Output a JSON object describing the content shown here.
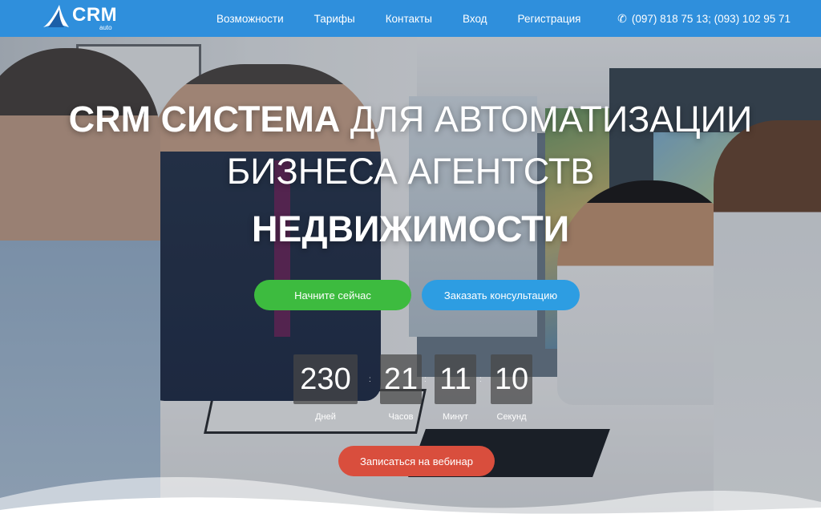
{
  "header": {
    "logo_text": "CRM",
    "logo_sub": "auto",
    "nav": [
      "Возможности",
      "Тарифы",
      "Контакты",
      "Вход",
      "Регистрация"
    ],
    "phone": "(097) 818 75 13; (093) 102 95 71"
  },
  "hero": {
    "title_bold": "CRM СИСТЕМА",
    "title_light": "ДЛЯ АВТОМАТИЗАЦИИ",
    "title_line2": "БИЗНЕСА АГЕНТСТВ",
    "title_line3": "НЕДВИЖИМОСТИ",
    "btn_start": "Начните сейчас",
    "btn_consult": "Заказать консультацию",
    "btn_webinar": "Записаться на вебинар"
  },
  "timer": {
    "days": "230",
    "hours": "21",
    "minutes": "11",
    "seconds": "10",
    "days_label": "Дней",
    "hours_label": "Часов",
    "minutes_label": "Минут",
    "seconds_label": "Секунд"
  },
  "colors": {
    "header": "#2f8fdc",
    "green": "#3dbb3f",
    "blue": "#2d9de2",
    "red": "#d94e3d"
  }
}
